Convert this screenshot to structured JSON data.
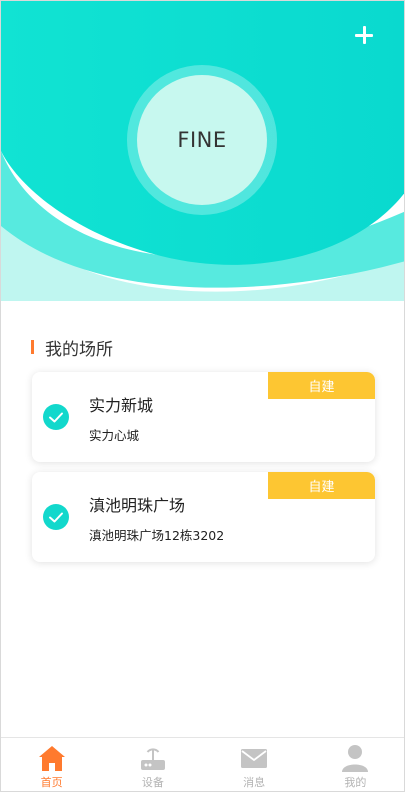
{
  "header": {
    "add_icon": "plus-icon",
    "avatar_text": "FINE",
    "colors": {
      "teal": "#12ded0",
      "teal_light": "#4be8dc",
      "teal_pale": "#bff6f0"
    }
  },
  "section": {
    "title": "我的场所",
    "accent_color": "#ff7a2e"
  },
  "places": [
    {
      "name": "实力新城",
      "address": "实力心城",
      "tag": "自建",
      "status_icon": "check-circle-icon"
    },
    {
      "name": "滇池明珠广场",
      "address": "滇池明珠广场12栋3202",
      "tag": "自建",
      "status_icon": "check-circle-icon"
    }
  ],
  "tag_color": "#fdc632",
  "tabs": [
    {
      "label": "首页",
      "icon": "home-icon",
      "active": true
    },
    {
      "label": "设备",
      "icon": "router-icon",
      "active": false
    },
    {
      "label": "消息",
      "icon": "mail-icon",
      "active": false
    },
    {
      "label": "我的",
      "icon": "user-icon",
      "active": false
    }
  ]
}
